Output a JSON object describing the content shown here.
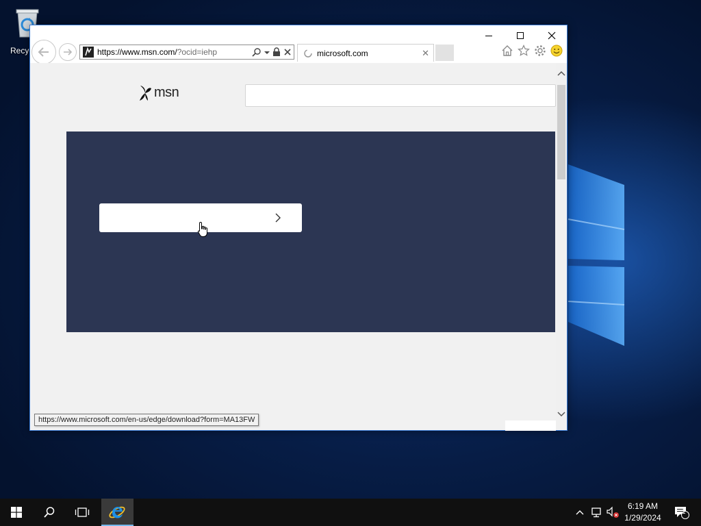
{
  "desktop": {
    "recycle_bin_label": "Recycl"
  },
  "browser": {
    "address": {
      "url_host": "https://www.msn.com/",
      "url_rest": "?ocid=iehp"
    },
    "tab": {
      "title": "microsoft.com",
      "close_glyph": "✕"
    },
    "status_tooltip": "https://www.microsoft.com/en-us/edge/download?form=MA13FW",
    "page": {
      "logo_text": "msn",
      "hero_color": "#2c3653"
    }
  },
  "icons": {
    "back": "back-arrow-icon",
    "forward": "forward-arrow-icon",
    "search": "search-icon",
    "lock": "lock-icon",
    "stop": "close-icon",
    "home": "home-icon",
    "favorites": "star-icon",
    "tools": "gear-icon",
    "feedback": "smiley-icon"
  },
  "taskbar": {
    "time": "6:19 AM",
    "date": "1/29/2024",
    "notification_count": "1"
  },
  "colors": {
    "accent": "#3a7bd5",
    "taskbar": "#101010",
    "ie_blue": "#1e90e6"
  }
}
